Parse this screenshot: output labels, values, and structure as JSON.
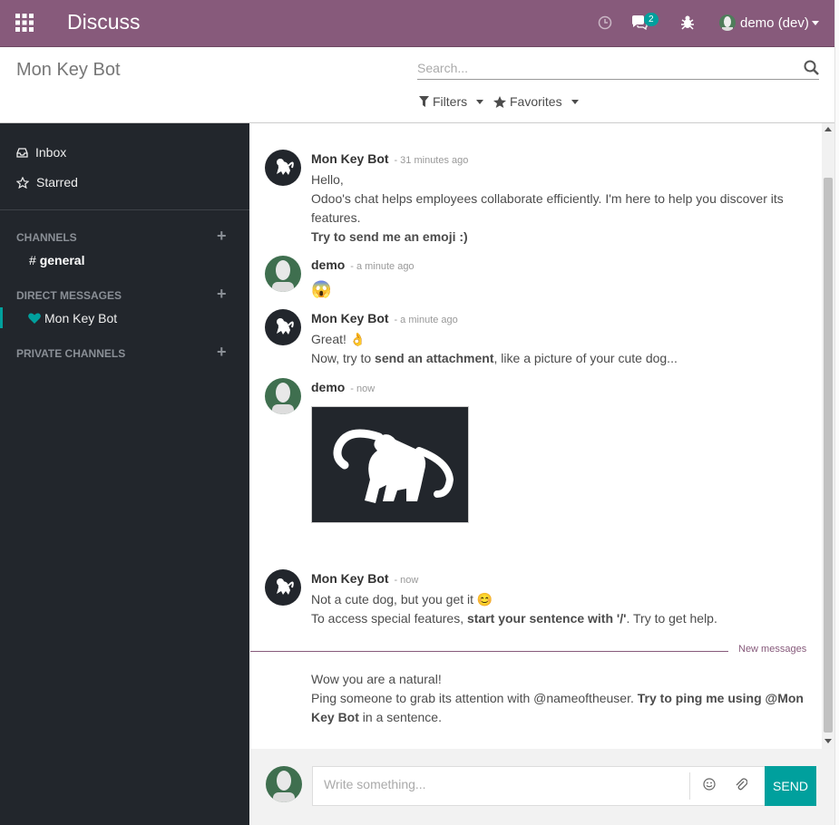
{
  "topbar": {
    "app_title": "Discuss",
    "chat_badge": "2",
    "user_name": "demo (dev)",
    "icons": [
      "apps-icon",
      "clock-icon",
      "chat-icon",
      "bug-icon",
      "avatar",
      "caret-down-icon"
    ],
    "bg_color": "#875a7b"
  },
  "control_panel": {
    "breadcrumb": "Mon Key Bot",
    "search_placeholder": "Search...",
    "filters_label": "Filters",
    "favorites_label": "Favorites"
  },
  "sidebar": {
    "inbox": "Inbox",
    "starred": "Starred",
    "channels_header": "CHANNELS",
    "channel_general_hash": "#",
    "channel_general": "general",
    "dm_header": "DIRECT MESSAGES",
    "dm_monkeybot": "Mon Key Bot",
    "private_header": "PRIVATE CHANNELS"
  },
  "messages": [
    {
      "author": "Mon Key Bot",
      "time": "- 31 minutes ago",
      "line1": "Hello,",
      "line2": "Odoo's chat helps employees collaborate efficiently. I'm here to help you discover its features.",
      "line3": "Try to send me an emoji :)"
    },
    {
      "author": "demo",
      "time": "- a minute ago",
      "emoji": "😱"
    },
    {
      "author": "Mon Key Bot",
      "time": "- a minute ago",
      "line1": "Great! 👌",
      "line2_pre": "Now, try to ",
      "line2_bold": "send an attachment",
      "line2_post": ", like a picture of your cute dog..."
    },
    {
      "author": "demo",
      "time": "- now"
    },
    {
      "author": "Mon Key Bot",
      "time": "- now",
      "line1": "Not a cute dog, but you get it 😊",
      "line2_pre": "To access special features, ",
      "line2_bold": "start your sentence with '/'",
      "line2_post": ". Try to get help."
    },
    {
      "line1": "Wow you are a natural!",
      "line2_pre": "Ping someone to grab its attention with @nameoftheuser. ",
      "line2_bold": "Try to ping me using @Mon Key Bot",
      "line2_post": " in a sentence."
    }
  ],
  "new_messages_label": "New messages",
  "composer": {
    "placeholder": "Write something...",
    "send_label": "SEND",
    "accent_color": "#00a09d"
  }
}
